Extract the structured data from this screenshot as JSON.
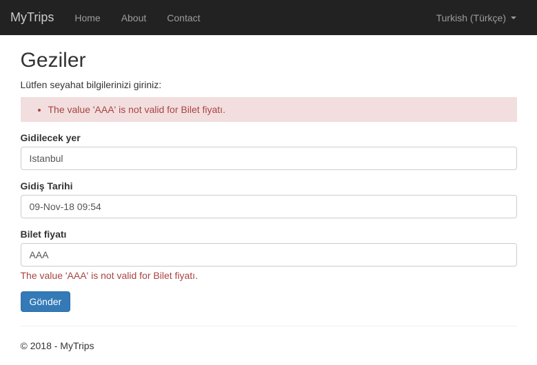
{
  "navbar": {
    "brand": "MyTrips",
    "links": [
      {
        "label": "Home"
      },
      {
        "label": "About"
      },
      {
        "label": "Contact"
      }
    ],
    "language": "Turkish (Türkçe)"
  },
  "page": {
    "title": "Geziler",
    "subtitle": "Lütfen seyahat bilgilerinizi giriniz:"
  },
  "validation": {
    "errors": [
      "The value 'AAA' is not valid for Bilet fiyatı."
    ]
  },
  "form": {
    "destination": {
      "label": "Gidilecek yer",
      "value": "Istanbul"
    },
    "leavingDate": {
      "label": "Gidiş Tarihi",
      "value": "09-Nov-18 09:54"
    },
    "ticketPrice": {
      "label": "Bilet fiyatı",
      "value": "AAA",
      "error": "The value 'AAA' is not valid for Bilet fiyatı."
    },
    "submit": "Gönder"
  },
  "footer": {
    "text": "© 2018 - MyTrips"
  }
}
